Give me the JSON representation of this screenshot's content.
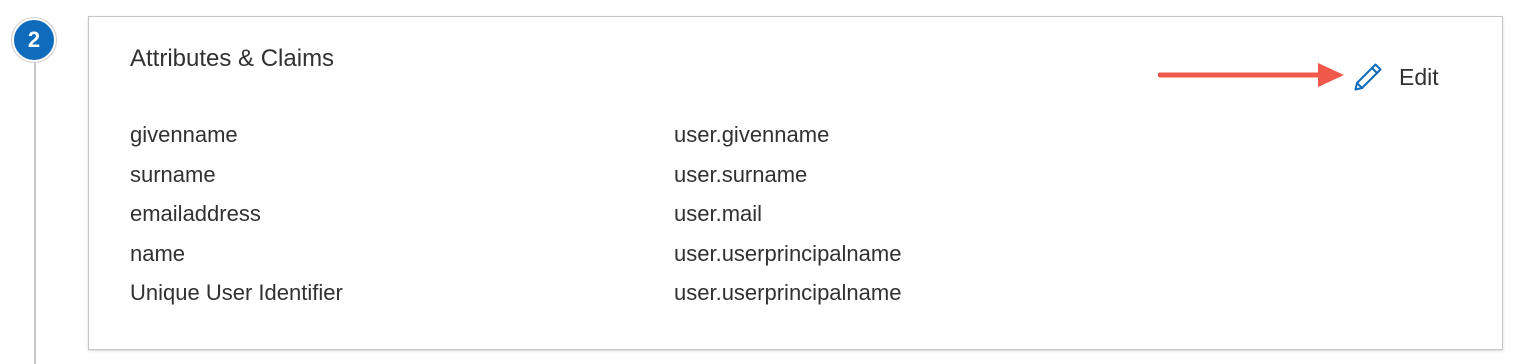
{
  "step": {
    "number": "2",
    "badge_color": "#0f6cbd"
  },
  "section": {
    "title": "Attributes & Claims",
    "edit_label": "Edit",
    "edit_icon": "pencil-icon",
    "annotation_arrow_color": "#f0584a"
  },
  "claims": [
    {
      "name": "givenname",
      "value": "user.givenname"
    },
    {
      "name": "surname",
      "value": "user.surname"
    },
    {
      "name": "emailaddress",
      "value": "user.mail"
    },
    {
      "name": "name",
      "value": "user.userprincipalname"
    },
    {
      "name": "Unique User Identifier",
      "value": "user.userprincipalname"
    }
  ]
}
